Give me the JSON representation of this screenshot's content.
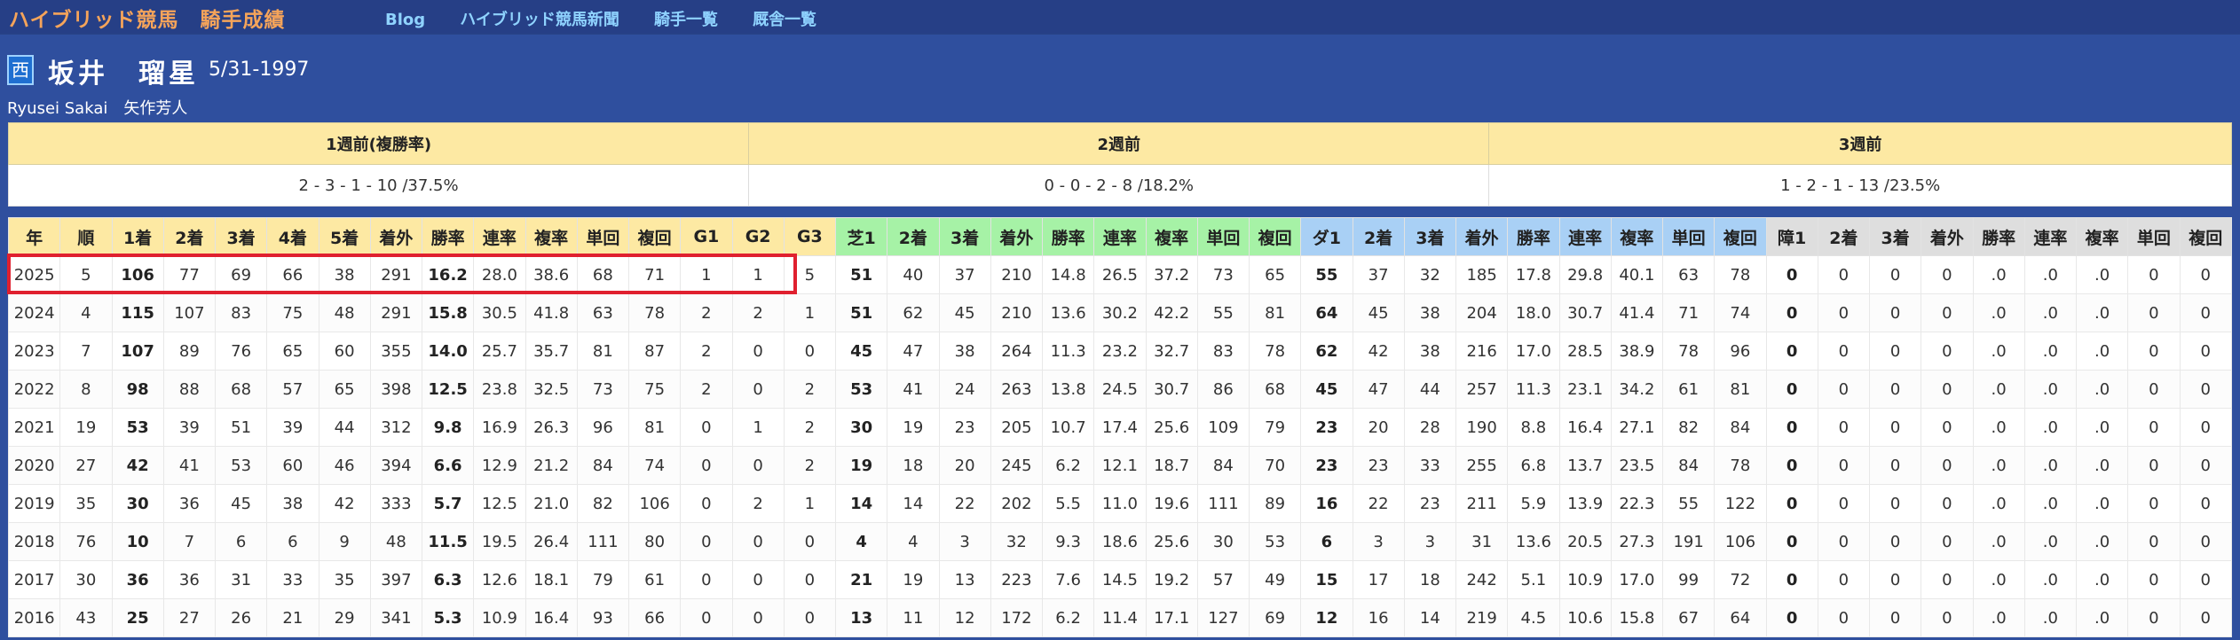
{
  "site": {
    "brand": "ハイブリッド競馬",
    "section": "騎手成績",
    "nav": [
      "Blog",
      "ハイブリッド競馬新聞",
      "騎手一覧",
      "厩舎一覧"
    ]
  },
  "jockey": {
    "region_badge": "西",
    "name": "坂井　瑠星",
    "birthday": "5/31-1997",
    "name_en": "Ryusei Sakai",
    "stable": "矢作芳人"
  },
  "recent": {
    "headers": [
      "1週前(複勝率)",
      "2週前",
      "3週前"
    ],
    "values": [
      "2 - 3 - 1 - 10 /37.5%",
      "0 - 0 - 2 - 8 /18.2%",
      "1 - 2 - 1 - 13 /23.5%"
    ]
  },
  "table": {
    "headers": [
      "年",
      "順",
      "1着",
      "2着",
      "3着",
      "4着",
      "5着",
      "着外",
      "勝率",
      "連率",
      "複率",
      "単回",
      "複回",
      "G1",
      "G2",
      "G3",
      "芝1",
      "2着",
      "3着",
      "着外",
      "勝率",
      "連率",
      "複率",
      "単回",
      "複回",
      "ダ1",
      "2着",
      "3着",
      "着外",
      "勝率",
      "連率",
      "複率",
      "単回",
      "複回",
      "障1",
      "2着",
      "3着",
      "着外",
      "勝率",
      "連率",
      "複率",
      "単回",
      "複回"
    ],
    "rows": [
      [
        "2025",
        "5",
        "106",
        "77",
        "69",
        "66",
        "38",
        "291",
        "16.2",
        "28.0",
        "38.6",
        "68",
        "71",
        "1",
        "1",
        "5",
        "51",
        "40",
        "37",
        "210",
        "14.8",
        "26.5",
        "37.2",
        "73",
        "65",
        "55",
        "37",
        "32",
        "185",
        "17.8",
        "29.8",
        "40.1",
        "63",
        "78",
        "0",
        "0",
        "0",
        "0",
        ".0",
        ".0",
        ".0",
        "0",
        "0"
      ],
      [
        "2024",
        "4",
        "115",
        "107",
        "83",
        "75",
        "48",
        "291",
        "15.8",
        "30.5",
        "41.8",
        "63",
        "78",
        "2",
        "2",
        "1",
        "51",
        "62",
        "45",
        "210",
        "13.6",
        "30.2",
        "42.2",
        "55",
        "81",
        "64",
        "45",
        "38",
        "204",
        "18.0",
        "30.7",
        "41.4",
        "71",
        "74",
        "0",
        "0",
        "0",
        "0",
        ".0",
        ".0",
        ".0",
        "0",
        "0"
      ],
      [
        "2023",
        "7",
        "107",
        "89",
        "76",
        "65",
        "60",
        "355",
        "14.0",
        "25.7",
        "35.7",
        "81",
        "87",
        "2",
        "0",
        "0",
        "45",
        "47",
        "38",
        "264",
        "11.3",
        "23.2",
        "32.7",
        "83",
        "78",
        "62",
        "42",
        "38",
        "216",
        "17.0",
        "28.5",
        "38.9",
        "78",
        "96",
        "0",
        "0",
        "0",
        "0",
        ".0",
        ".0",
        ".0",
        "0",
        "0"
      ],
      [
        "2022",
        "8",
        "98",
        "88",
        "68",
        "57",
        "65",
        "398",
        "12.5",
        "23.8",
        "32.5",
        "73",
        "75",
        "2",
        "0",
        "2",
        "53",
        "41",
        "24",
        "263",
        "13.8",
        "24.5",
        "30.7",
        "86",
        "68",
        "45",
        "47",
        "44",
        "257",
        "11.3",
        "23.1",
        "34.2",
        "61",
        "81",
        "0",
        "0",
        "0",
        "0",
        ".0",
        ".0",
        ".0",
        "0",
        "0"
      ],
      [
        "2021",
        "19",
        "53",
        "39",
        "51",
        "39",
        "44",
        "312",
        "9.8",
        "16.9",
        "26.3",
        "96",
        "81",
        "0",
        "1",
        "2",
        "30",
        "19",
        "23",
        "205",
        "10.7",
        "17.4",
        "25.6",
        "109",
        "79",
        "23",
        "20",
        "28",
        "190",
        "8.8",
        "16.4",
        "27.1",
        "82",
        "84",
        "0",
        "0",
        "0",
        "0",
        ".0",
        ".0",
        ".0",
        "0",
        "0"
      ],
      [
        "2020",
        "27",
        "42",
        "41",
        "53",
        "60",
        "46",
        "394",
        "6.6",
        "12.9",
        "21.2",
        "84",
        "74",
        "0",
        "0",
        "2",
        "19",
        "18",
        "20",
        "245",
        "6.2",
        "12.1",
        "18.7",
        "84",
        "70",
        "23",
        "23",
        "33",
        "255",
        "6.8",
        "13.7",
        "23.5",
        "84",
        "78",
        "0",
        "0",
        "0",
        "0",
        ".0",
        ".0",
        ".0",
        "0",
        "0"
      ],
      [
        "2019",
        "35",
        "30",
        "36",
        "45",
        "38",
        "42",
        "333",
        "5.7",
        "12.5",
        "21.0",
        "82",
        "106",
        "0",
        "2",
        "1",
        "14",
        "14",
        "22",
        "202",
        "5.5",
        "11.0",
        "19.6",
        "111",
        "89",
        "16",
        "22",
        "23",
        "211",
        "5.9",
        "13.9",
        "22.3",
        "55",
        "122",
        "0",
        "0",
        "0",
        "0",
        ".0",
        ".0",
        ".0",
        "0",
        "0"
      ],
      [
        "2018",
        "76",
        "10",
        "7",
        "6",
        "6",
        "9",
        "48",
        "11.5",
        "19.5",
        "26.4",
        "111",
        "80",
        "0",
        "0",
        "0",
        "4",
        "4",
        "3",
        "32",
        "9.3",
        "18.6",
        "25.6",
        "30",
        "53",
        "6",
        "3",
        "3",
        "31",
        "13.6",
        "20.5",
        "27.3",
        "191",
        "106",
        "0",
        "0",
        "0",
        "0",
        ".0",
        ".0",
        ".0",
        "0",
        "0"
      ],
      [
        "2017",
        "30",
        "36",
        "36",
        "31",
        "33",
        "35",
        "397",
        "6.3",
        "12.6",
        "18.1",
        "79",
        "61",
        "0",
        "0",
        "0",
        "21",
        "19",
        "13",
        "223",
        "7.6",
        "14.5",
        "19.2",
        "57",
        "49",
        "15",
        "17",
        "18",
        "242",
        "5.1",
        "10.9",
        "17.0",
        "99",
        "72",
        "0",
        "0",
        "0",
        "0",
        ".0",
        ".0",
        ".0",
        "0",
        "0"
      ],
      [
        "2016",
        "43",
        "25",
        "27",
        "26",
        "21",
        "29",
        "341",
        "5.3",
        "10.9",
        "16.4",
        "93",
        "66",
        "0",
        "0",
        "0",
        "13",
        "11",
        "12",
        "172",
        "6.2",
        "11.4",
        "17.1",
        "127",
        "69",
        "12",
        "16",
        "14",
        "219",
        "4.5",
        "10.6",
        "15.8",
        "67",
        "64",
        "0",
        "0",
        "0",
        "0",
        ".0",
        ".0",
        ".0",
        "0",
        "0"
      ]
    ]
  },
  "colors": {
    "background": "#2f4f9e",
    "header_general": "#fde9a3",
    "header_turf": "#a6f2a6",
    "header_dirt": "#a9d0f5",
    "header_hurdle": "#dedede",
    "highlight_border": "#e0202f",
    "brand": "#f5a45a",
    "nav": "#8fd3ff"
  }
}
